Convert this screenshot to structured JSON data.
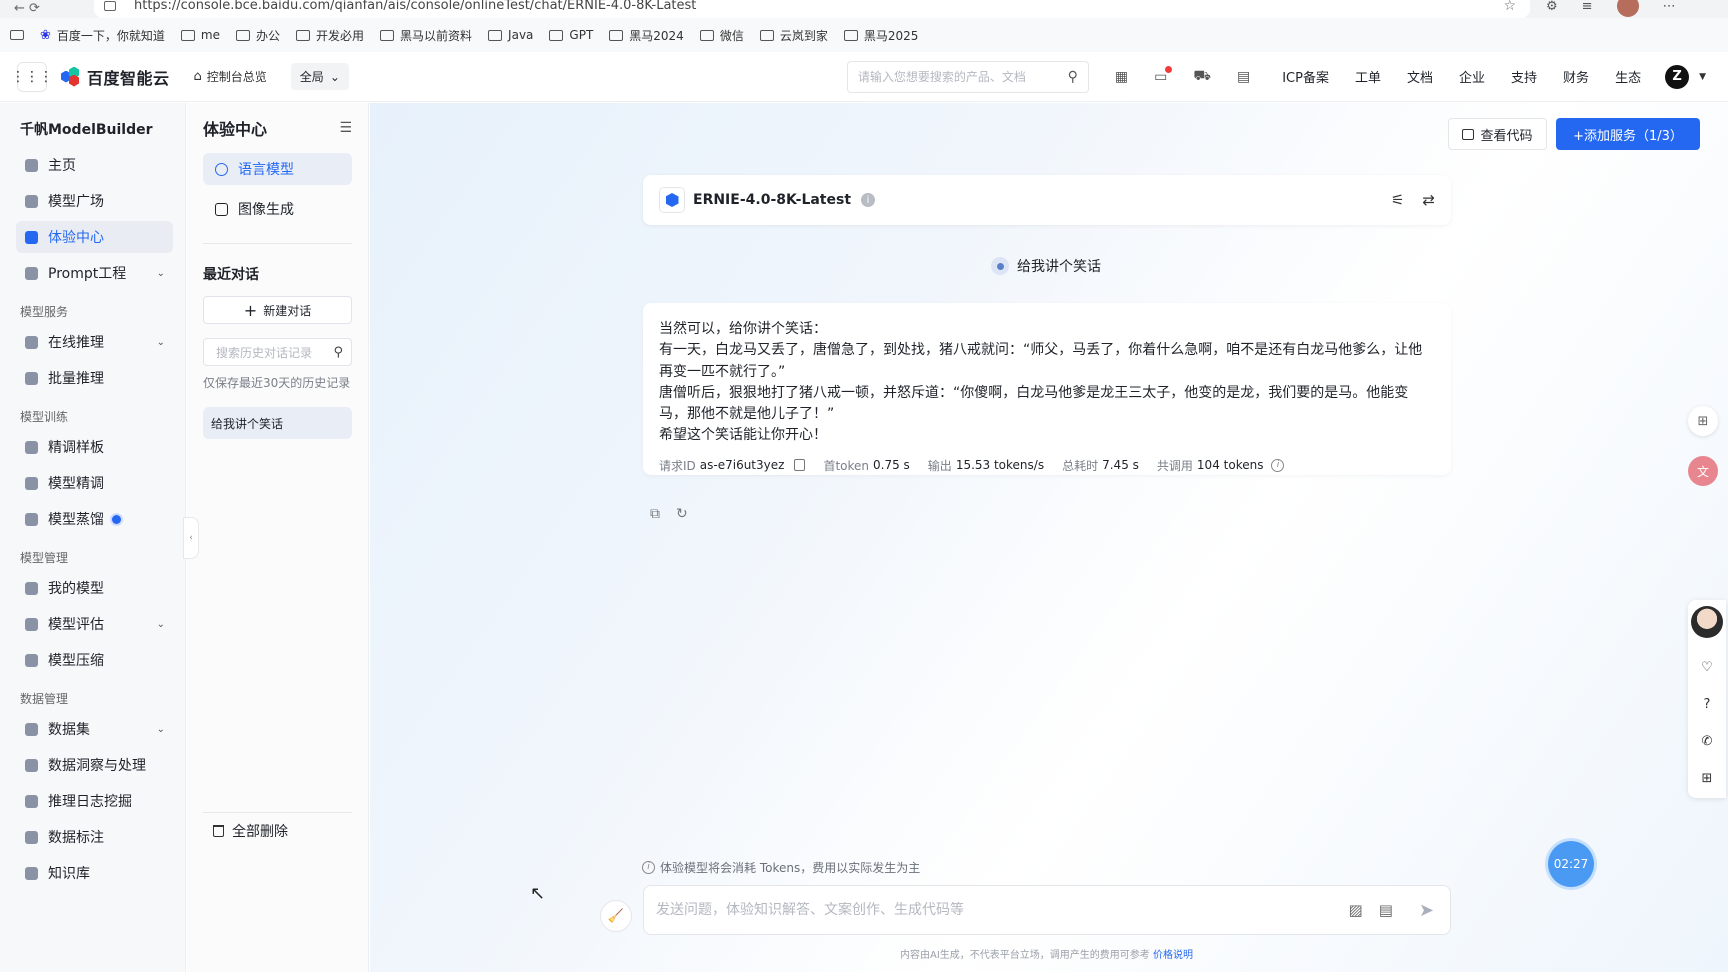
{
  "browser": {
    "url": "https://console.bce.baidu.com/qianfan/ais/console/onlineTest/chat/ERNIE-4.0-8K-Latest",
    "bookmarks": [
      "百度一下，你就知道",
      "me",
      "办公",
      "开发必用",
      "黑马以前资料",
      "Java",
      "GPT",
      "黑马2024",
      "微信",
      "云岚到家",
      "黑马2025"
    ]
  },
  "header": {
    "brand": "百度智能云",
    "console_link": "控制台总览",
    "region": "全局",
    "search_placeholder": "请输入您想要搜索的产品、文档",
    "links": [
      "ICP备案",
      "工单",
      "文档",
      "企业",
      "支持",
      "财务",
      "生态"
    ],
    "user_initial": "Z"
  },
  "sidebar": {
    "title": "千帆ModelBuilder",
    "items_top": [
      {
        "label": "主页"
      },
      {
        "label": "模型广场"
      },
      {
        "label": "体验中心",
        "active": true
      },
      {
        "label": "Prompt工程",
        "expand": true
      }
    ],
    "sections": [
      {
        "title": "模型服务",
        "items": [
          {
            "label": "在线推理",
            "expand": true
          },
          {
            "label": "批量推理"
          }
        ]
      },
      {
        "title": "模型训练",
        "items": [
          {
            "label": "精调样板"
          },
          {
            "label": "模型精调"
          },
          {
            "label": "模型蒸馏",
            "badge": true
          }
        ]
      },
      {
        "title": "模型管理",
        "items": [
          {
            "label": "我的模型"
          },
          {
            "label": "模型评估",
            "expand": true
          },
          {
            "label": "模型压缩"
          }
        ]
      },
      {
        "title": "数据管理",
        "items": [
          {
            "label": "数据集",
            "expand": true
          },
          {
            "label": "数据洞察与处理"
          },
          {
            "label": "推理日志挖掘"
          },
          {
            "label": "数据标注"
          },
          {
            "label": "知识库"
          }
        ]
      }
    ]
  },
  "experience": {
    "title": "体验中心",
    "items": [
      "语言模型",
      "图像生成"
    ],
    "recent_title": "最近对话",
    "new_chat": "新建对话",
    "history_placeholder": "搜索历史对话记录",
    "history_note": "仅保存最近30天的历史记录",
    "history": [
      "给我讲个笑话"
    ],
    "delete_all": "全部删除"
  },
  "main": {
    "view_code": "查看代码",
    "add_service": "+添加服务（1/3）",
    "model_name": "ERNIE-4.0-8K-Latest",
    "user_message": "给我讲个笑话",
    "answer_lines": [
      "当然可以，给你讲个笑话：",
      "有一天，白龙马又丢了，唐僧急了，到处找，猪八戒就问：“师父，马丢了，你着什么急啊，咱不是还有白龙马他爹么，让他",
      "再变一匹不就行了。”",
      "唐僧听后，狠狠地打了猪八戒一顿，并怒斥道：“你傻啊，白龙马他爹是龙王三太子，他变的是龙，我们要的是马。他能变",
      "马，那他不就是他儿子了！”",
      "希望这个笑话能让你开心！"
    ],
    "meta": {
      "request_id_label": "请求ID",
      "request_id": "as-e7i6ut3yez",
      "first_token_label": "首token",
      "first_token": "0.75 s",
      "output_label": "输出",
      "output": "15.53 tokens/s",
      "total_time_label": "总耗时",
      "total_time": "7.45 s",
      "total_label": "共调用",
      "total": "104 tokens"
    },
    "notice": "体验模型将会消耗 Tokens，费用以实际发生为主",
    "timer": "02:27",
    "input_placeholder": "发送问题，体验知识解答、文案创作、生成代码等",
    "footnote": "内容由AI生成，不代表平台立场，调用产生的费用可参考",
    "footnote_link": "价格说明"
  },
  "colors": {
    "accent": "#2468f2",
    "sidebar_bg": "#f7f8fa"
  }
}
